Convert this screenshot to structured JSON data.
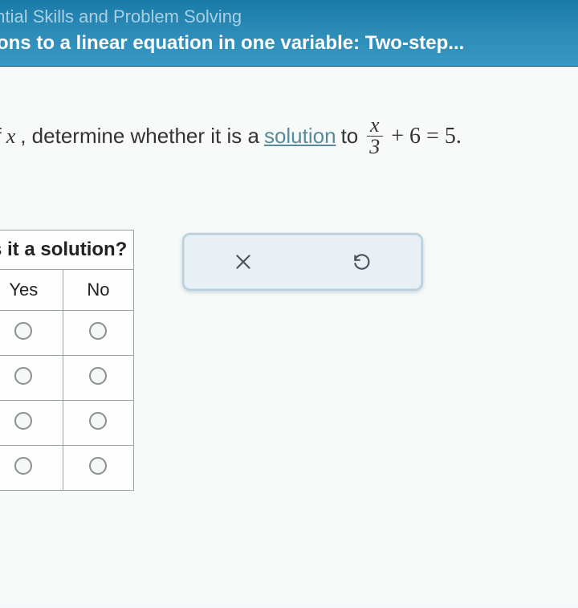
{
  "header": {
    "breadcrumb": "ssential Skills and Problem Solving",
    "title": "lutions to a linear equation in one variable: Two-step..."
  },
  "question": {
    "prefix": " of ",
    "var": "x",
    "mid1": ", determine whether it is a ",
    "link": "solution",
    "mid2": " to ",
    "frac_num": "x",
    "frac_den": "3",
    "rest": " + 6 = 5."
  },
  "table": {
    "header": "s it a solution?",
    "col_yes": "Yes",
    "col_no": "No",
    "rows": 4
  },
  "toolbar": {
    "clear": "clear",
    "reset": "reset"
  }
}
